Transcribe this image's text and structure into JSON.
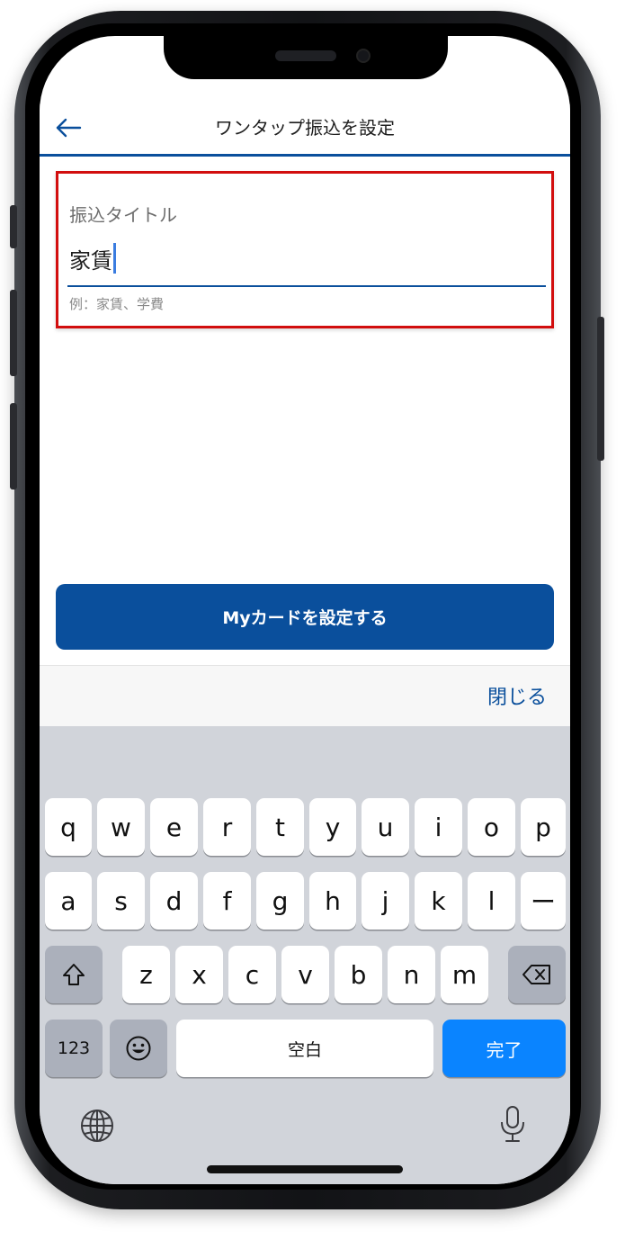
{
  "header": {
    "title": "ワンタップ振込を設定",
    "back_icon": "arrow-left-icon"
  },
  "form": {
    "label": "振込タイトル",
    "value": "家賃",
    "hint": "例：家賃、学費",
    "highlight_color": "#d20e0e"
  },
  "actions": {
    "primary_label": "Myカードを設定する",
    "close_label": "閉じる"
  },
  "keyboard": {
    "row1": [
      "q",
      "w",
      "e",
      "r",
      "t",
      "y",
      "u",
      "i",
      "o",
      "p"
    ],
    "row2": [
      "a",
      "s",
      "d",
      "f",
      "g",
      "h",
      "j",
      "k",
      "l",
      "ー"
    ],
    "row3": [
      "z",
      "x",
      "c",
      "v",
      "b",
      "n",
      "m"
    ],
    "numbers_label": "123",
    "space_label": "空白",
    "done_label": "完了",
    "icons": {
      "shift": "shift-icon",
      "delete": "delete-icon",
      "emoji": "emoji-icon",
      "globe": "globe-icon",
      "mic": "microphone-icon"
    }
  },
  "colors": {
    "brand": "#0a4f9c",
    "done_key": "#0a84ff",
    "keyboard_bg": "#d1d4da"
  }
}
